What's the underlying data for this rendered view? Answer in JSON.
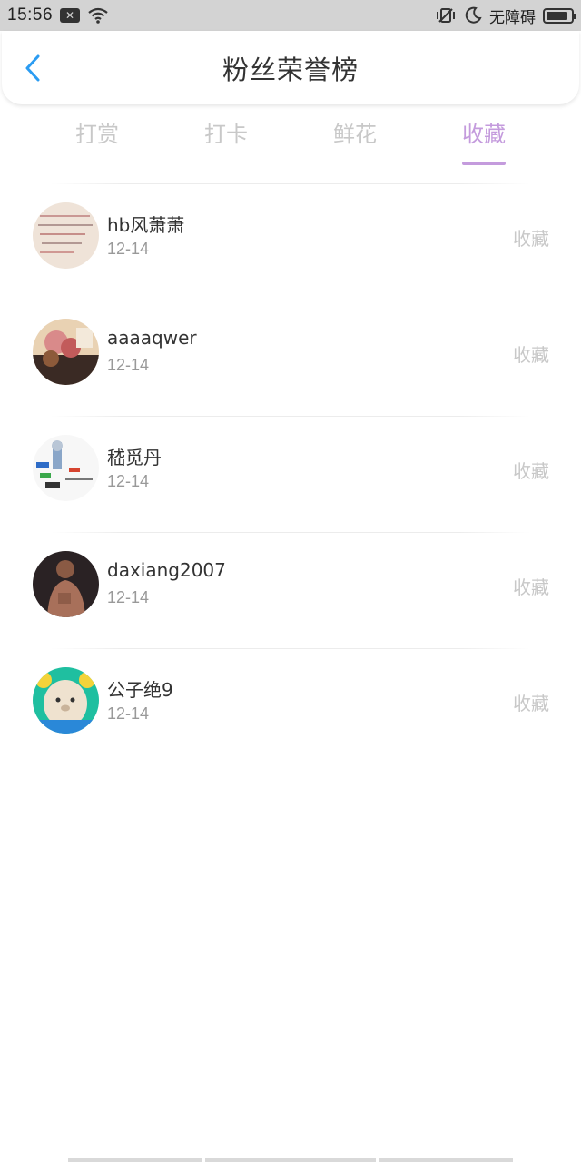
{
  "status_bar": {
    "time": "15:56",
    "carrier": "无障碍",
    "battery_level": 0.9
  },
  "header": {
    "title": "粉丝荣誉榜",
    "back_icon": "chevron-left-icon",
    "accent_color": "#2b9cf2"
  },
  "tabs": [
    {
      "label": "打赏",
      "active": false
    },
    {
      "label": "打卡",
      "active": false
    },
    {
      "label": "鲜花",
      "active": false
    },
    {
      "label": "收藏",
      "active": true
    }
  ],
  "tab_active_color": "#c49bdd",
  "fans": [
    {
      "name": "hb风萧萧",
      "date": "12-14",
      "action": "收藏",
      "avatar": "handwritten-note-avatar"
    },
    {
      "name": "aaaaqwer",
      "date": "12-14",
      "action": "收藏",
      "avatar": "flowers-avatar"
    },
    {
      "name": "嵇觅丹",
      "date": "12-14",
      "action": "收藏",
      "avatar": "drawing-avatar"
    },
    {
      "name": "daxiang2007",
      "date": "12-14",
      "action": "收藏",
      "avatar": "person-avatar"
    },
    {
      "name": "公子绝9",
      "date": "12-14",
      "action": "收藏",
      "avatar": "cartoon-bear-avatar"
    }
  ]
}
